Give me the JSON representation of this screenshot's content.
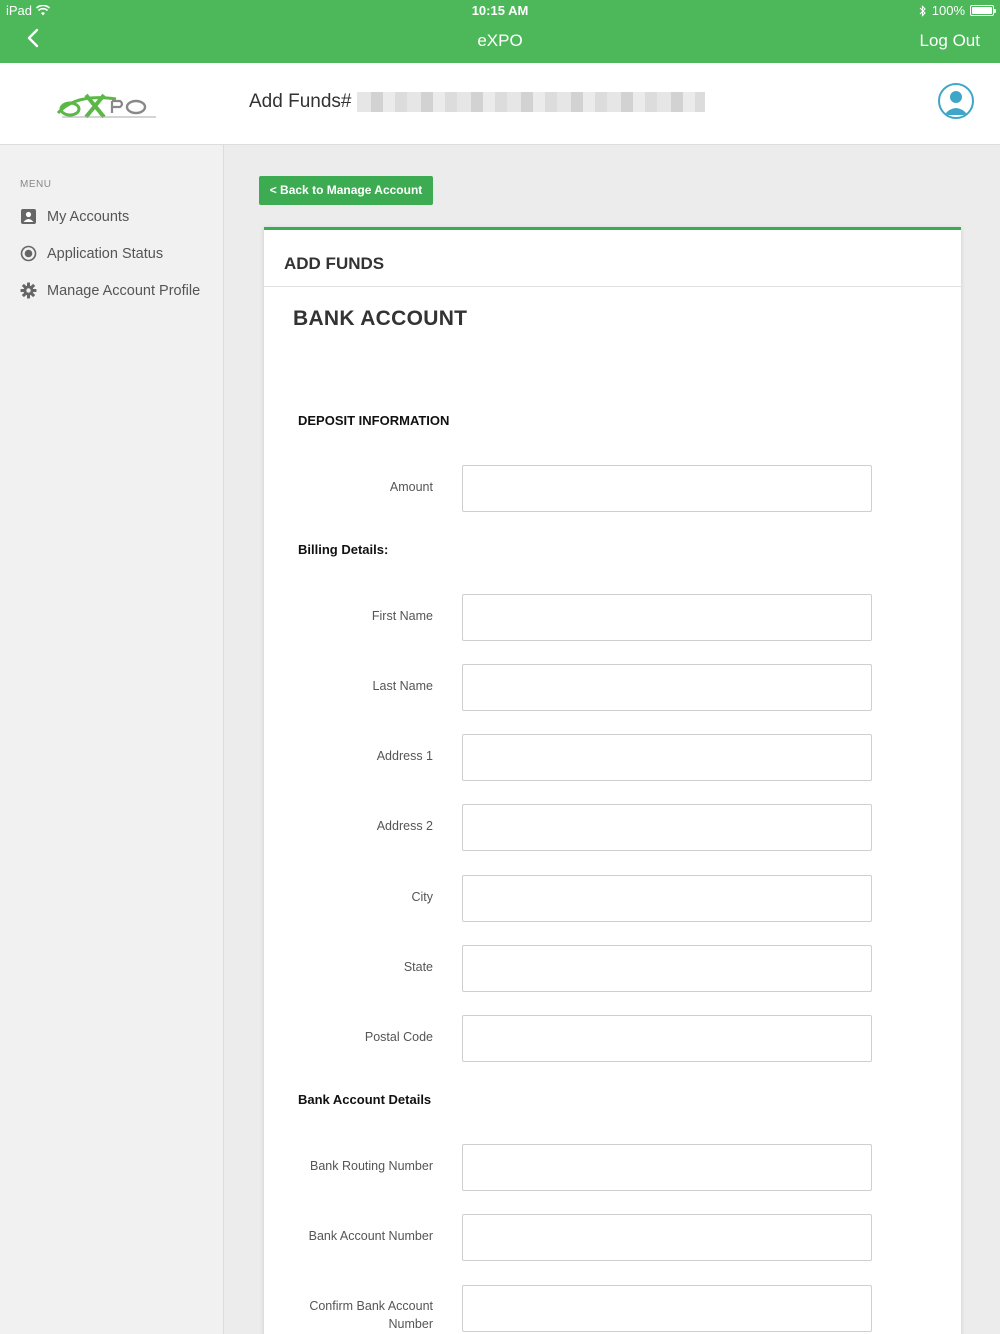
{
  "status_bar": {
    "device": "iPad",
    "time": "10:15 AM",
    "battery": "100%"
  },
  "nav": {
    "title": "eXPO",
    "logout_label": "Log Out"
  },
  "header": {
    "title": "Add Funds#"
  },
  "sidebar": {
    "menu_label": "MENU",
    "items": [
      {
        "label": "My Accounts",
        "icon": "account-box-icon"
      },
      {
        "label": "Application Status",
        "icon": "radio-dot-icon"
      },
      {
        "label": "Manage Account Profile",
        "icon": "gear-icon"
      }
    ]
  },
  "back_button": {
    "label": "< Back to Manage Account"
  },
  "card": {
    "title": "ADD FUNDS",
    "section_title": "BANK ACCOUNT",
    "deposit_heading": "DEPOSIT INFORMATION",
    "billing_heading": "Billing Details:",
    "bank_heading": "Bank Account Details",
    "fields": {
      "amount": {
        "label": "Amount",
        "value": ""
      },
      "first_name": {
        "label": "First Name",
        "value": ""
      },
      "last_name": {
        "label": "Last Name",
        "value": ""
      },
      "address1": {
        "label": "Address 1",
        "value": ""
      },
      "address2": {
        "label": "Address 2",
        "value": ""
      },
      "city": {
        "label": "City",
        "value": ""
      },
      "state": {
        "label": "State",
        "value": ""
      },
      "postal_code": {
        "label": "Postal Code",
        "value": ""
      },
      "routing_number": {
        "label": "Bank Routing Number",
        "value": ""
      },
      "account_number": {
        "label": "Bank Account Number",
        "value": ""
      },
      "confirm_account_number": {
        "label": "Confirm Bank Account Number",
        "value": ""
      }
    }
  },
  "colors": {
    "brand_green": "#4cb85a",
    "button_green": "#3cab52",
    "avatar_blue": "#40a6c8"
  }
}
